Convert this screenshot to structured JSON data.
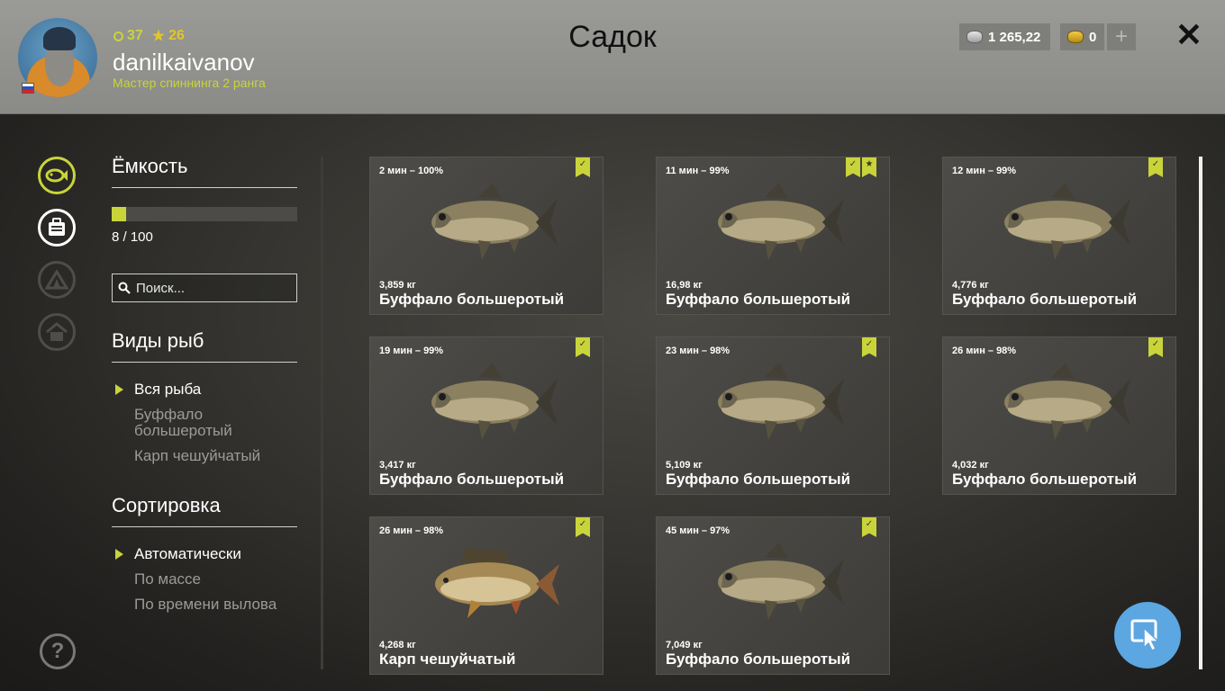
{
  "header": {
    "title": "Садок",
    "username": "danilkaivanov",
    "rank": "Мастер спиннинга 2 ранга",
    "level": "37",
    "stars": "26",
    "silver": "1 265,22",
    "gold": "0",
    "plus_label": "+",
    "close_label": "✕"
  },
  "capacity": {
    "title": "Ёмкость",
    "used": 8,
    "max": 100,
    "fill_fraction": 0.08,
    "text": "8 / 100"
  },
  "search": {
    "placeholder": "Поиск..."
  },
  "species": {
    "title": "Виды рыб",
    "items": [
      "Вся рыба",
      "Буффало большеротый",
      "Карп чешуйчатый"
    ],
    "selected": "Вся рыба"
  },
  "sort": {
    "title": "Сортировка",
    "items": [
      "Автоматически",
      "По массе",
      "По времени вылова"
    ],
    "selected": "Автоматически"
  },
  "help_label": "?",
  "fish": [
    {
      "time": "2 мин – 100%",
      "weight": "3,859 кг",
      "name": "Буффало большеротый",
      "star": false,
      "kind": "buffalo"
    },
    {
      "time": "11 мин – 99%",
      "weight": "16,98 кг",
      "name": "Буффало большеротый",
      "star": true,
      "kind": "buffalo"
    },
    {
      "time": "12 мин – 99%",
      "weight": "4,776 кг",
      "name": "Буффало большеротый",
      "star": false,
      "kind": "buffalo"
    },
    {
      "time": "19 мин – 99%",
      "weight": "3,417 кг",
      "name": "Буффало большеротый",
      "star": false,
      "kind": "buffalo"
    },
    {
      "time": "23 мин – 98%",
      "weight": "5,109 кг",
      "name": "Буффало большеротый",
      "star": false,
      "kind": "buffalo"
    },
    {
      "time": "26 мин – 98%",
      "weight": "4,032 кг",
      "name": "Буффало большеротый",
      "star": false,
      "kind": "buffalo"
    },
    {
      "time": "26 мин – 98%",
      "weight": "4,268 кг",
      "name": "Карп чешуйчатый",
      "star": false,
      "kind": "carp"
    },
    {
      "time": "45 мин – 97%",
      "weight": "7,049 кг",
      "name": "Буффало большеротый",
      "star": false,
      "kind": "buffalo"
    }
  ]
}
